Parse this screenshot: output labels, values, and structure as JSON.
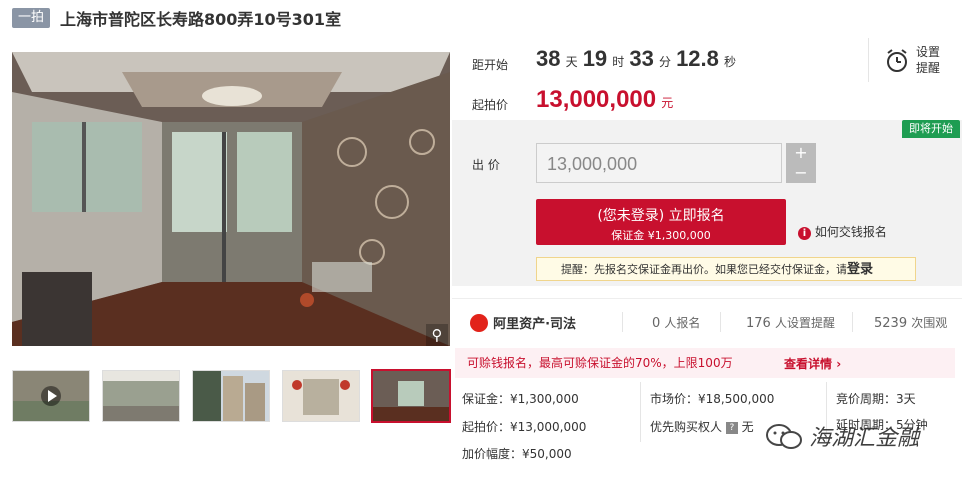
{
  "title": {
    "badge": "一拍",
    "text": "上海市普陀区长寿路800弄10号301室"
  },
  "countdown": {
    "label": "距开始",
    "days": "38",
    "days_unit": "天",
    "hours": "19",
    "hours_unit": "时",
    "minutes": "33",
    "minutes_unit": "分",
    "seconds": "12.8",
    "seconds_unit": "秒"
  },
  "reminder": {
    "line1": "设置",
    "line2": "提醒"
  },
  "start_price": {
    "label": "起拍价",
    "value": "13,000,000",
    "unit": "元"
  },
  "bid": {
    "label": "出 价",
    "value": "13,000,000",
    "plus": "+",
    "minus": "−",
    "status_tag": "即将开始",
    "button_line1": "(您未登录) 立即报名",
    "button_line2": "保证金 ¥1,300,000",
    "deposit_help": "如何交钱报名",
    "tip_prefix": "提醒：先报名交保证金再出价。如果您已经交付保证金，请",
    "tip_login": "登录"
  },
  "stats": {
    "brand": "阿里资产·司法",
    "signups": "0",
    "signups_label": "人报名",
    "reminders": "176",
    "reminders_label": "人设置提醒",
    "views": "5239",
    "views_label": "次围观"
  },
  "notice": {
    "text": "可赊钱报名，最高可赊保证金的70%，上限100万",
    "link": "查看详情"
  },
  "info": {
    "deposit": "保证金：¥1,300,000",
    "start_price": "起拍价：¥13,000,000",
    "increment": "加价幅度：¥50,000",
    "market_price": "市场价：¥18,500,000",
    "priority_label": "优先购买权人",
    "priority_value": "无",
    "cycle": "竞价周期：3天",
    "delay": "延时周期：5分钟"
  },
  "watermark": "海湖汇金融",
  "colors": {
    "accent": "#c8102e",
    "green": "#1e9d52"
  }
}
